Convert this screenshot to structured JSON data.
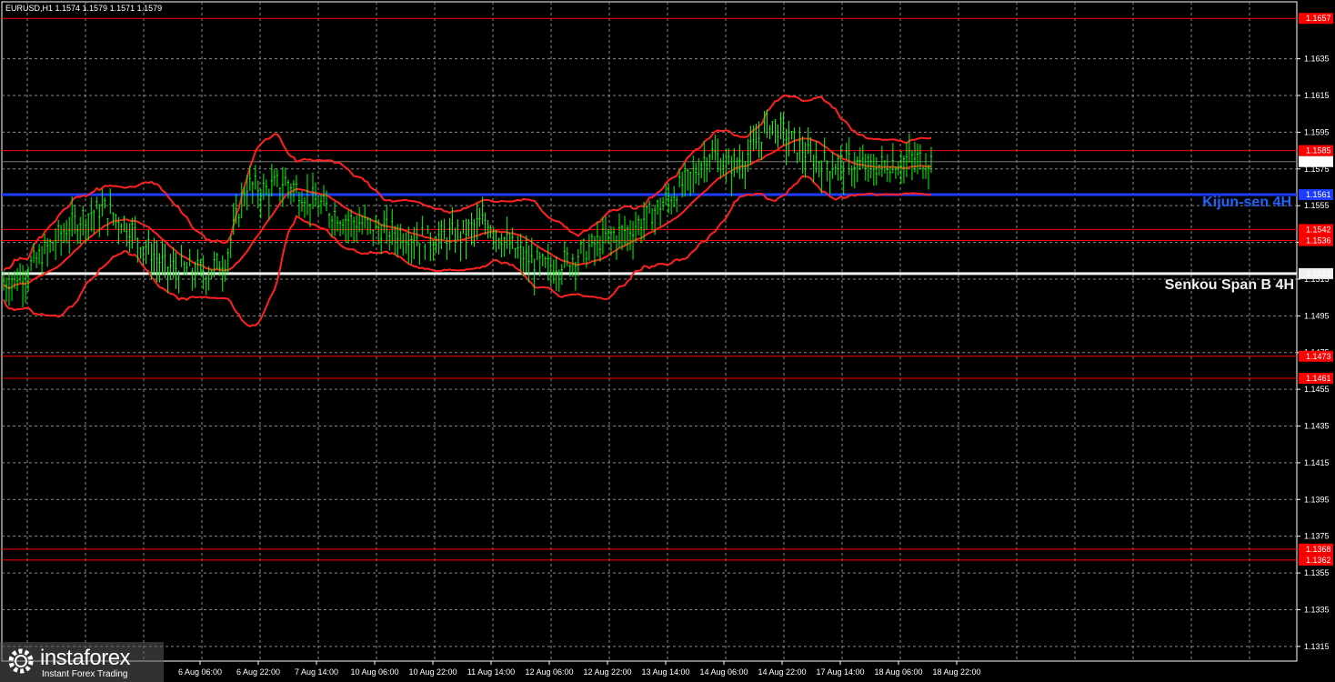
{
  "header": {
    "symbol_line": "EURUSD,H1  1.1574 1.1579 1.1571 1.1579"
  },
  "logo": {
    "name": "instaforex",
    "tagline": "Instant Forex Trading"
  },
  "labels": {
    "kijun": "Kijun-sen 4H",
    "senkou": "Senkou Span B 4H"
  },
  "colors": {
    "background": "#000000",
    "grid": "#8a8a8a",
    "axis": "#ffffff",
    "candle": "#00ff00",
    "bands": "#ff2020",
    "kijun": "#1e3cff",
    "senkou": "#f0f0f0",
    "level": "#ff0000",
    "level_label_bg": "#ff0000"
  },
  "chart_data": {
    "type": "candlestick",
    "symbol": "EURUSD",
    "timeframe": "H1",
    "ohlc_last": {
      "open": 1.1574,
      "high": 1.1579,
      "low": 1.1571,
      "close": 1.1579
    },
    "ylim": [
      1.1307,
      1.1667
    ],
    "yticks": [
      "1.1635",
      "1.1615",
      "1.1595",
      "1.1575",
      "1.1555",
      "1.1535",
      "1.1515",
      "1.1495",
      "1.1475",
      "1.1455",
      "1.1435",
      "1.1415",
      "1.1395",
      "1.1375",
      "1.1355",
      "1.1335",
      "1.1315"
    ],
    "xticks": [
      "6 Aug 06:00",
      "6 Aug 22:00",
      "7 Aug 14:00",
      "10 Aug 06:00",
      "10 Aug 22:00",
      "11 Aug 14:00",
      "12 Aug 06:00",
      "12 Aug 22:00",
      "13 Aug 14:00",
      "14 Aug 06:00",
      "14 Aug 22:00",
      "17 Aug 14:00",
      "18 Aug 06:00",
      "18 Aug 22:00"
    ],
    "levels": [
      {
        "value": 1.1657,
        "label": "1.1657",
        "color": "#ff0000"
      },
      {
        "value": 1.1585,
        "label": "1.1585",
        "color": "#ff0000"
      },
      {
        "value": 1.1542,
        "label": "1.1542",
        "color": "#ff0000"
      },
      {
        "value": 1.1536,
        "label": "1.1536",
        "color": "#ff0000"
      },
      {
        "value": 1.1473,
        "label": "1.1473",
        "color": "#ff0000"
      },
      {
        "value": 1.1461,
        "label": "1.1461",
        "color": "#ff0000"
      },
      {
        "value": 1.1368,
        "label": "1.1368",
        "color": "#ff0000"
      },
      {
        "value": 1.1362,
        "label": "1.1362",
        "color": "#ff0000"
      }
    ],
    "current_price": {
      "value": 1.1579,
      "label": "1.1579"
    },
    "kijun_sen": {
      "value": 1.1561,
      "label": "1.1561"
    },
    "senkou_span_b": {
      "value": 1.1518,
      "label": "1.1518"
    },
    "close_series": [
      1.1512,
      1.1517,
      1.1528,
      1.154,
      1.1548,
      1.1552,
      1.1545,
      1.1532,
      1.152,
      1.1519,
      1.1518,
      1.1524,
      1.1565,
      1.1562,
      1.1567,
      1.1559,
      1.1552,
      1.1546,
      1.1543,
      1.154,
      1.1538,
      1.1536,
      1.1537,
      1.154,
      1.1546,
      1.1533,
      1.1524,
      1.152,
      1.1524,
      1.153,
      1.1537,
      1.154,
      1.1548,
      1.1558,
      1.1568,
      1.1583,
      1.1575,
      1.1582,
      1.16,
      1.159,
      1.158,
      1.1576,
      1.1577,
      1.1574,
      1.1577,
      1.1579,
      1.1578
    ]
  }
}
